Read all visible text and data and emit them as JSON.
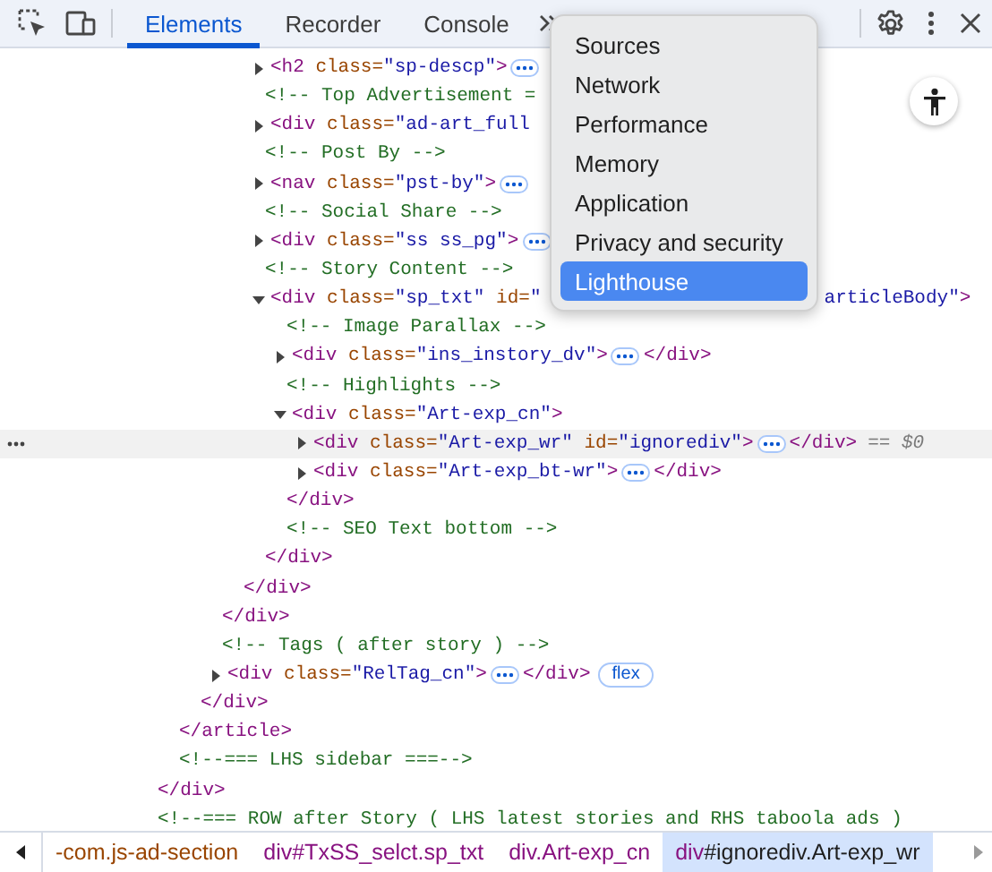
{
  "toolbar": {
    "tabs": [
      {
        "label": "Elements",
        "selected": true
      },
      {
        "label": "Recorder",
        "selected": false
      },
      {
        "label": "Console",
        "selected": false
      }
    ]
  },
  "more_menu": {
    "items": [
      {
        "label": "Sources",
        "selected": false
      },
      {
        "label": "Network",
        "selected": false
      },
      {
        "label": "Performance",
        "selected": false
      },
      {
        "label": "Memory",
        "selected": false
      },
      {
        "label": "Application",
        "selected": false
      },
      {
        "label": "Privacy and security",
        "selected": false
      },
      {
        "label": "Lighthouse",
        "selected": true
      }
    ]
  },
  "tree": [
    {
      "kind": "ancestor",
      "close": [
        {
          "kind": "tag",
          "s": "</div>"
        }
      ],
      "children": [
        {
          "kind": "ancestor",
          "close": [
            {
              "kind": "tag",
              "s": "</article>"
            }
          ],
          "children": [
            {
              "kind": "ancestor",
              "close": [
                {
                  "kind": "tag",
                  "s": "</div>"
                }
              ],
              "children": [
                {
                  "kind": "ancestor",
                  "close": [
                    {
                      "kind": "tag",
                      "s": "</div>"
                    }
                  ],
                  "children": [
                    {
                      "kind": "ancestor",
                      "close": [
                        {
                          "kind": "tag",
                          "s": "</div>"
                        }
                      ],
                      "children": [
                        {
                          "kind": "element",
                          "selected": false,
                          "expanded": false,
                          "open": [
                            {
                              "kind": "tag",
                              "s": "<h2"
                            },
                            {
                              "kind": "attr",
                              "s": "class="
                            },
                            {
                              "kind": "value",
                              "s": "\"sp-descp\""
                            },
                            {
                              "kind": "tag",
                              "s": ">"
                            }
                          ],
                          "more": true
                        },
                        {
                          "kind": "comment",
                          "selected": false,
                          "text": "<!-- Top Advertisement ="
                        },
                        {
                          "kind": "element",
                          "selected": false,
                          "expanded": false,
                          "open": [
                            {
                              "kind": "tag",
                              "s": "<div"
                            },
                            {
                              "kind": "attr",
                              "s": "class="
                            },
                            {
                              "kind": "value",
                              "s": "\"ad-art_full"
                            }
                          ],
                          "more": false
                        },
                        {
                          "kind": "comment",
                          "selected": false,
                          "text": "<!-- Post By -->"
                        },
                        {
                          "kind": "element",
                          "selected": false,
                          "expanded": false,
                          "open": [
                            {
                              "kind": "tag",
                              "s": "<nav"
                            },
                            {
                              "kind": "attr",
                              "s": "class="
                            },
                            {
                              "kind": "value",
                              "s": "\"pst-by\""
                            },
                            {
                              "kind": "tag",
                              "s": ">"
                            }
                          ],
                          "more": true
                        },
                        {
                          "kind": "comment",
                          "selected": false,
                          "text": "<!-- Social Share -->"
                        },
                        {
                          "kind": "element",
                          "selected": false,
                          "expanded": false,
                          "open": [
                            {
                              "kind": "tag",
                              "s": "<div"
                            },
                            {
                              "kind": "attr",
                              "s": "class="
                            },
                            {
                              "kind": "value",
                              "s": "\"ss ss_pg\""
                            },
                            {
                              "kind": "tag",
                              "s": ">"
                            }
                          ],
                          "more": true
                        },
                        {
                          "kind": "comment",
                          "selected": false,
                          "text": "<!-- Story Content -->"
                        },
                        {
                          "kind": "element",
                          "selected": false,
                          "expanded": true,
                          "open": [
                            {
                              "kind": "tag",
                              "s": "<div"
                            },
                            {
                              "kind": "attr",
                              "s": "class="
                            },
                            {
                              "kind": "value",
                              "s": "\"sp_txt\""
                            },
                            {
                              "kind": "attr",
                              "s": "id="
                            },
                            {
                              "kind": "value",
                              "s": "\""
                            },
                            {
                              "kind": "covered"
                            },
                            {
                              "kind": "value",
                              "s": "articleBody\""
                            },
                            {
                              "kind": "tag",
                              "s": ">"
                            }
                          ],
                          "more": false,
                          "close": [
                            {
                              "kind": "tag",
                              "s": "</div>"
                            }
                          ],
                          "children": [
                            {
                              "kind": "comment",
                              "selected": false,
                              "text": "<!-- Image Parallax -->"
                            },
                            {
                              "kind": "element",
                              "selected": false,
                              "expanded": false,
                              "open": [
                                {
                                  "kind": "tag",
                                  "s": "<div"
                                },
                                {
                                  "kind": "attr",
                                  "s": "class="
                                },
                                {
                                  "kind": "value",
                                  "s": "\"ins_instory_dv\""
                                },
                                {
                                  "kind": "tag",
                                  "s": ">"
                                }
                              ],
                              "more": true,
                              "close": [
                                {
                                  "kind": "tag",
                                  "s": "</div>"
                                }
                              ]
                            },
                            {
                              "kind": "comment",
                              "selected": false,
                              "text": "<!-- Highlights -->"
                            },
                            {
                              "kind": "element",
                              "selected": false,
                              "expanded": true,
                              "open": [
                                {
                                  "kind": "tag",
                                  "s": "<div"
                                },
                                {
                                  "kind": "attr",
                                  "s": "class="
                                },
                                {
                                  "kind": "value",
                                  "s": "\"Art-exp_cn\""
                                },
                                {
                                  "kind": "tag",
                                  "s": ">"
                                }
                              ],
                              "more": false,
                              "close": [
                                {
                                  "kind": "tag",
                                  "s": "</div>"
                                }
                              ],
                              "children": [
                                {
                                  "kind": "element",
                                  "selected": true,
                                  "expanded": false,
                                  "open": [
                                    {
                                      "kind": "tag",
                                      "s": "<div"
                                    },
                                    {
                                      "kind": "attr",
                                      "s": "class="
                                    },
                                    {
                                      "kind": "value",
                                      "s": "\"Art-exp_wr\""
                                    },
                                    {
                                      "kind": "attr",
                                      "s": "id="
                                    },
                                    {
                                      "kind": "value",
                                      "s": "\"ignorediv\""
                                    },
                                    {
                                      "kind": "tag",
                                      "s": ">"
                                    }
                                  ],
                                  "more": true,
                                  "close": [
                                    {
                                      "kind": "tag",
                                      "s": "</div>"
                                    }
                                  ],
                                  "console_ref": "== $0"
                                },
                                {
                                  "kind": "element",
                                  "selected": false,
                                  "expanded": false,
                                  "open": [
                                    {
                                      "kind": "tag",
                                      "s": "<div"
                                    },
                                    {
                                      "kind": "attr",
                                      "s": "class="
                                    },
                                    {
                                      "kind": "value",
                                      "s": "\"Art-exp_bt-wr\""
                                    },
                                    {
                                      "kind": "tag",
                                      "s": ">"
                                    }
                                  ],
                                  "more": true,
                                  "close": [
                                    {
                                      "kind": "tag",
                                      "s": "</div>"
                                    }
                                  ]
                                }
                              ]
                            },
                            {
                              "kind": "comment",
                              "selected": false,
                              "text": "<!-- SEO Text bottom -->"
                            }
                          ]
                        }
                      ]
                    }
                  ]
                },
                {
                  "kind": "comment",
                  "selected": false,
                  "text": "<!-- Tags ( after story ) -->"
                },
                {
                  "kind": "element",
                  "selected": false,
                  "expanded": false,
                  "open": [
                    {
                      "kind": "tag",
                      "s": "<div"
                    },
                    {
                      "kind": "attr",
                      "s": "class="
                    },
                    {
                      "kind": "value",
                      "s": "\"RelTag_cn\""
                    },
                    {
                      "kind": "tag",
                      "s": ">"
                    }
                  ],
                  "more": true,
                  "close": [
                    {
                      "kind": "tag",
                      "s": "</div>"
                    }
                  ],
                  "badge": "flex"
                }
              ]
            }
          ]
        },
        {
          "kind": "comment",
          "selected": false,
          "text": "<!--=== LHS sidebar ===-->"
        }
      ]
    },
    {
      "kind": "comment",
      "selected": false,
      "text": "<!--=== ROW after Story ( LHS latest stories and RHS taboola ads )"
    }
  ],
  "breadcrumbs": [
    {
      "selected": false,
      "parts": [
        {
          "kind": "attr",
          "s": "-com.js-ad-section"
        }
      ]
    },
    {
      "selected": false,
      "parts": [
        {
          "kind": "tag",
          "s": "div"
        },
        {
          "kind": "rest",
          "s": "#TxSS_selct.sp_txt"
        }
      ]
    },
    {
      "selected": false,
      "parts": [
        {
          "kind": "tag",
          "s": "div"
        },
        {
          "kind": "rest",
          "s": ".Art-exp_cn"
        }
      ]
    },
    {
      "selected": true,
      "parts": [
        {
          "kind": "tag",
          "s": "div"
        },
        {
          "kind": "rest",
          "s": "#ignorediv.Art-exp_wr"
        }
      ]
    }
  ]
}
